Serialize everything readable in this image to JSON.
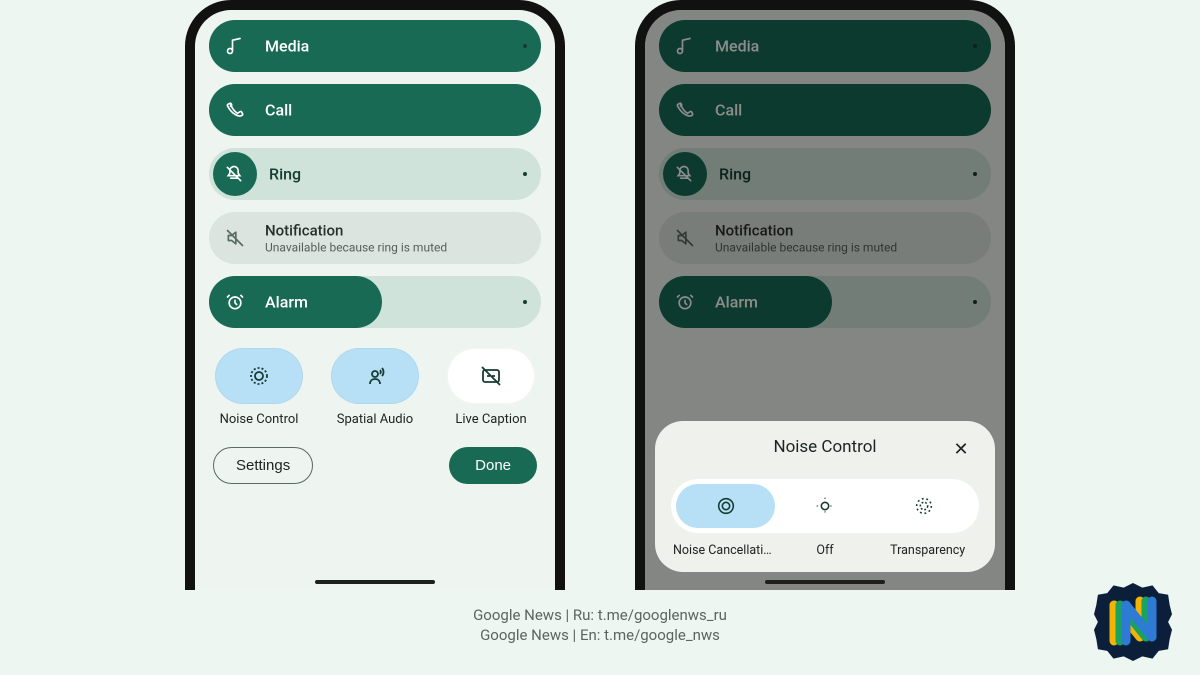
{
  "rows": {
    "media": {
      "label": "Media",
      "fill": 100
    },
    "call": {
      "label": "Call",
      "fill": 100
    },
    "ring": {
      "label": "Ring",
      "fill": 0
    },
    "notif": {
      "label": "Notification",
      "sub": "Unavailable because ring is muted"
    },
    "alarm": {
      "label": "Alarm",
      "fill": 52
    }
  },
  "chips": {
    "noise": {
      "label": "Noise Control"
    },
    "spatial": {
      "label": "Spatial Audio"
    },
    "caption": {
      "label": "Live Caption"
    }
  },
  "buttons": {
    "settings": "Settings",
    "done": "Done"
  },
  "sheet": {
    "title": "Noise Control",
    "options": {
      "anc": "Noise Cancellati…",
      "off": "Off",
      "trans": "Transparency"
    }
  },
  "attrib": {
    "l1": "Google News | Ru: t.me/googlenws_ru",
    "l2": "Google News | En: t.me/google_nws"
  }
}
